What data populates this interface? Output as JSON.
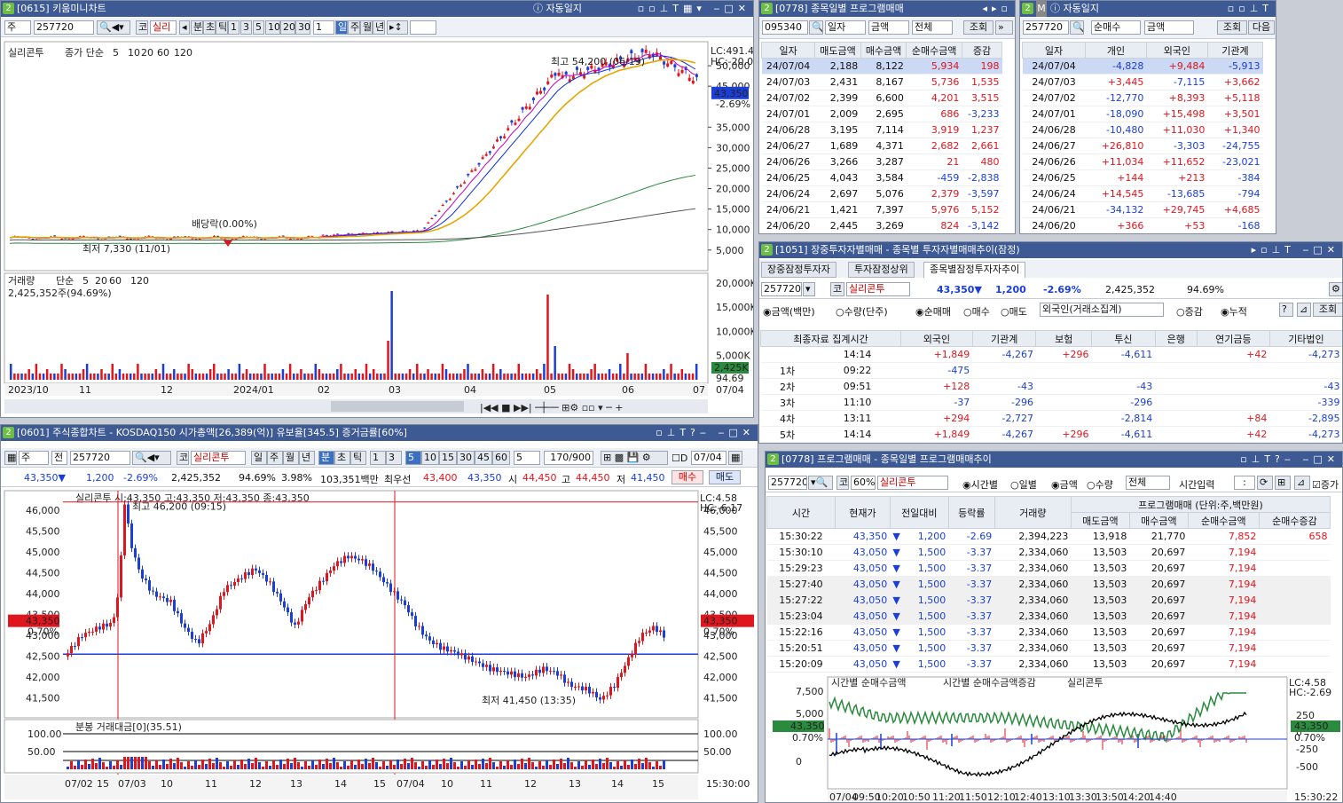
{
  "w1": {
    "title": "[0615] 키움미니차트",
    "auto": "자동일지",
    "unit": "주",
    "code": "257720",
    "mkt": "코",
    "name": "실리",
    "tabs": [
      "분",
      "초",
      "틱"
    ],
    "nums": [
      "1",
      "3",
      "5",
      "10",
      "20",
      "30"
    ],
    "n": "1",
    "periods": [
      "일",
      "주",
      "월",
      "년"
    ],
    "legend": {
      "name": "실리콘투",
      "ma": "종가 단순",
      "m1": "5",
      "m2": "10",
      "m3": "20",
      "m4": "60",
      "m5": "120"
    },
    "lc": "LC:491.4",
    "hc": "HC:-20.0",
    "price": "43,350",
    "pct": "-2.69%",
    "hi": "최고 54,200 (06/19)",
    "lo": "최저 7,330 (11/01)",
    "div": "배당락(0.00%)",
    "yaxis": [
      "50,000",
      "45,000",
      "35,000",
      "30,000",
      "25,000",
      "20,000",
      "15,000",
      "10,000",
      "5,000"
    ],
    "vol": {
      "name": "거래량",
      "ma": "단순",
      "m1": "5",
      "m2": "20",
      "m3": "60",
      "m4": "120",
      "val": "2,425,352주(94.69%)",
      "yaxis": [
        "20,000K",
        "15,000K",
        "10,000K",
        "5,000K"
      ],
      "cur": "2,425K",
      "pct": "94.69"
    },
    "xaxis": [
      "2023/10",
      "11",
      "12",
      "2024/01",
      "02",
      "03",
      "04",
      "05",
      "06",
      "07",
      "07/04"
    ]
  },
  "w2": {
    "title": "[0778] 종목일별 프로그램매매",
    "code": "095340",
    "unit": "일자",
    "kind": "금액",
    "all": "전체",
    "query": "조회",
    "cols": [
      "일자",
      "매도금액",
      "매수금액",
      "순매수금액",
      "증감"
    ],
    "rows": [
      [
        "24/07/04",
        "2,188",
        "8,122",
        "5,934",
        "198"
      ],
      [
        "24/07/03",
        "2,431",
        "8,167",
        "5,736",
        "1,535"
      ],
      [
        "24/07/02",
        "2,399",
        "6,600",
        "4,201",
        "3,515"
      ],
      [
        "24/07/01",
        "2,009",
        "2,695",
        "686",
        "-3,233"
      ],
      [
        "24/06/28",
        "3,195",
        "7,114",
        "3,919",
        "1,237"
      ],
      [
        "24/06/27",
        "1,689",
        "4,371",
        "2,682",
        "2,661"
      ],
      [
        "24/06/26",
        "3,266",
        "3,287",
        "21",
        "480"
      ],
      [
        "24/06/25",
        "4,043",
        "3,584",
        "-459",
        "-2,838"
      ],
      [
        "24/06/24",
        "2,697",
        "5,076",
        "2,379",
        "-3,597"
      ],
      [
        "24/06/21",
        "1,421",
        "7,397",
        "5,976",
        "5,152"
      ],
      [
        "24/06/20",
        "2,445",
        "3,269",
        "824",
        "-3,142"
      ]
    ]
  },
  "w3": {
    "auto": "자동일지",
    "code": "257720",
    "kind": "순매수",
    "amt": "금액",
    "query": "조회",
    "next": "다음",
    "cols": [
      "일자",
      "개인",
      "외국인",
      "기관계"
    ],
    "rows": [
      [
        "24/07/04",
        "-4,828",
        "+9,484",
        "-5,913"
      ],
      [
        "24/07/03",
        "+3,445",
        "-7,115",
        "+3,662"
      ],
      [
        "24/07/02",
        "-12,770",
        "+8,393",
        "+5,118"
      ],
      [
        "24/07/01",
        "-18,090",
        "+15,498",
        "+3,501"
      ],
      [
        "24/06/28",
        "-10,480",
        "+11,030",
        "+1,340"
      ],
      [
        "24/06/27",
        "+26,810",
        "-3,303",
        "-24,755"
      ],
      [
        "24/06/26",
        "+11,034",
        "+11,652",
        "-23,021"
      ],
      [
        "24/06/25",
        "+144",
        "+213",
        "-384"
      ],
      [
        "24/06/24",
        "+14,545",
        "-13,685",
        "-794"
      ],
      [
        "24/06/21",
        "-34,132",
        "+29,745",
        "+4,685"
      ],
      [
        "24/06/20",
        "+366",
        "+53",
        "-168"
      ]
    ]
  },
  "w4": {
    "title": "[1051] 장중투자자별매매 - 종목별 투자자별매매추이(잠정)",
    "tabs": [
      "장중잠정투자자",
      "투자잠정상위",
      "종목별잠정투자자추이"
    ],
    "code": "257720",
    "mkt": "코",
    "name": "실리콘투",
    "price": "43,350",
    "diff": "1,200",
    "pct": "-2.69%",
    "vol": "2,425,352",
    "vr": "94.69%",
    "opts": [
      "금액(백만)",
      "수량(단주)",
      "순매매",
      "매수",
      "매도"
    ],
    "investor": "외국인(거래소집계)",
    "opt2": [
      "증감",
      "누적"
    ],
    "query": "조회",
    "cols": [
      "최종자료 집계시간",
      "외국인",
      "기관계",
      "보험",
      "투신",
      "은행",
      "연기금등",
      "기타법인"
    ],
    "rows": [
      [
        "",
        "14:14",
        "+1,849",
        "-4,267",
        "+296",
        "-4,611",
        "",
        "+42",
        "-4,273"
      ],
      [
        "1차",
        "09:22",
        "-475",
        "",
        "",
        "",
        "",
        "",
        ""
      ],
      [
        "2차",
        "09:51",
        "+128",
        "-43",
        "",
        "-43",
        "",
        "",
        "-43"
      ],
      [
        "3차",
        "11:10",
        "-37",
        "-296",
        "",
        "-296",
        "",
        "",
        "-339"
      ],
      [
        "4차",
        "13:11",
        "+294",
        "-2,727",
        "",
        "-2,814",
        "",
        "+84",
        "-2,895"
      ],
      [
        "5차",
        "14:14",
        "+1,849",
        "-4,267",
        "+296",
        "-4,611",
        "",
        "+42",
        "-4,273"
      ]
    ]
  },
  "w5": {
    "title": "[0601] 주식종합차트 - KOSDAQ150 시가총액[26,389(억)] 유보율[345.5] 증거금률[60%]",
    "unit": "주",
    "jeon": "전",
    "code": "257720",
    "mkt": "코",
    "name": "실리콘투",
    "periods": [
      "일",
      "주",
      "월",
      "년",
      "분",
      "초",
      "틱"
    ],
    "nums": [
      "1",
      "3",
      "5",
      "10",
      "15",
      "30",
      "45",
      "60"
    ],
    "n": "5",
    "cnt": "170/900",
    "d": "D",
    "date": "07/04",
    "quote": {
      "price": "43,350",
      "diff": "1,200",
      "pct": "-2.69%",
      "vol": "2,425,352",
      "vr": "94.69%",
      "r2": "3.98%",
      "amt": "103,351백만",
      "bid_l": "최우선",
      "bid": "43,400",
      "ask": "43,350",
      "op_l": "시",
      "op": "44,450",
      "hi_l": "고",
      "hi": "44,450",
      "lo_l": "저",
      "lo": "41,450",
      "buy": "매수",
      "sell": "매도"
    },
    "legend": "실리콘투 시:43,350 고:43,350 저:43,350 종:43,350",
    "lc": "LC:4.58",
    "hc": "HC:-6.17",
    "hi": "최고 46,200 (09:15)",
    "lo": "최저 41,450 (13:35)",
    "cur": "43,350",
    "curpct": "0.70%",
    "yaxis": [
      "46,000",
      "45,500",
      "45,000",
      "44,500",
      "44,000",
      "43,500",
      "43,000",
      "42,500",
      "42,000",
      "41,500"
    ],
    "vol": "분봉 거래대금[0](35.51)",
    "vy": [
      "100.00",
      "50.00"
    ],
    "xaxis": [
      "07/02",
      "15",
      "07/03",
      "10",
      "11",
      "12",
      "13",
      "14",
      "15",
      "07/04",
      "10",
      "11",
      "12",
      "13",
      "14",
      "15"
    ],
    "xend": "15:30:00"
  },
  "w6": {
    "title": "[0778] 프로그램매매 - 종목일별 프로그램매매추이",
    "code": "257720",
    "mkt": "코",
    "pct60": "60%",
    "name": "실리콘투",
    "opts": [
      "시간별",
      "일별",
      "금액",
      "수량"
    ],
    "all": "전체",
    "timeinput": "시간입력",
    "colon": ":",
    "jeung": "증가",
    "unitnote": "프로그램매매 (단위:주,백만원)",
    "cols": [
      "시간",
      "현재가",
      "전일대비",
      "등락률",
      "거래량",
      "매도금액",
      "매수금액",
      "순매수금액",
      "순매수증감"
    ],
    "rows": [
      [
        "15:30:22",
        "43,350",
        "1,200",
        "-2.69",
        "2,394,223",
        "13,918",
        "21,770",
        "7,852",
        "658"
      ],
      [
        "15:30:10",
        "43,050",
        "1,500",
        "-3.37",
        "2,334,060",
        "13,503",
        "20,697",
        "7,194",
        ""
      ],
      [
        "15:29:23",
        "43,050",
        "1,500",
        "-3.37",
        "2,334,060",
        "13,503",
        "20,697",
        "7,194",
        ""
      ],
      [
        "15:27:40",
        "43,050",
        "1,500",
        "-3.37",
        "2,334,060",
        "13,503",
        "20,697",
        "7,194",
        ""
      ],
      [
        "15:27:22",
        "43,050",
        "1,500",
        "-3.37",
        "2,334,060",
        "13,503",
        "20,697",
        "7,194",
        ""
      ],
      [
        "15:23:04",
        "43,050",
        "1,500",
        "-3.37",
        "2,334,060",
        "13,503",
        "20,697",
        "7,194",
        ""
      ],
      [
        "15:22:16",
        "43,050",
        "1,500",
        "-3.37",
        "2,334,060",
        "13,503",
        "20,697",
        "7,194",
        ""
      ],
      [
        "15:20:51",
        "43,050",
        "1,500",
        "-3.37",
        "2,334,060",
        "13,503",
        "20,697",
        "7,194",
        ""
      ],
      [
        "15:20:09",
        "43,050",
        "1,500",
        "-3.37",
        "2,334,060",
        "13,503",
        "20,697",
        "7,194",
        ""
      ]
    ],
    "chart": {
      "l1": "시간별 순매수금액",
      "l2": "시간별 순매수금액증감",
      "l3": "실리콘투",
      "lc": "LC:4.58",
      "hc": "HC:-2.69",
      "cur": "43,350",
      "pct": "0.70%",
      "ly": [
        "7,500",
        "5,000",
        "0"
      ],
      "ry": [
        "250",
        "0",
        "-250",
        "-500"
      ],
      "x": [
        "07/04",
        "09:50",
        "10:20",
        "10:50",
        "11:20",
        "11:50",
        "12:10",
        "12:40",
        "13:10",
        "13:30",
        "13:50",
        "14:20",
        "14:40"
      ],
      "xend": "15:30:22"
    }
  }
}
